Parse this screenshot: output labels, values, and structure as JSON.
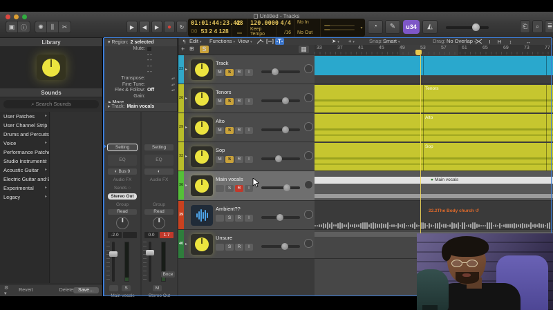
{
  "window": {
    "title": "Untitled - Tracks"
  },
  "lcd": {
    "smpte": "01:01:44:23.42",
    "position_ghost": "00",
    "position": "53 2 4 128",
    "midi_display": "48",
    "tempo": "120.0000",
    "tempo_mode": "Keep Tempo",
    "signature": "4/4",
    "division": "/16",
    "input": "No In",
    "output": "No Out"
  },
  "toolbar": {
    "badge": "u34"
  },
  "library": {
    "title": "Library",
    "sounds_title": "Sounds",
    "search_placeholder": "Search Sounds",
    "items": [
      "User Patches",
      "User Channel Strip S…",
      "Drums and Percussion",
      "Voice",
      "Performance Patches",
      "Studio Instruments",
      "Acoustic Guitar",
      "Electric Guitar and Ba…",
      "Experimental",
      "Legacy"
    ],
    "footer": {
      "revert": "Revert",
      "delete": "Delete",
      "save": "Save…"
    }
  },
  "inspector": {
    "region_label": "Region:",
    "region_value": "2 selected",
    "mute_label": "Mute:",
    "dash_rows": [
      "- -",
      "- -",
      "- -",
      "- -"
    ],
    "transpose_label": "Transpose:",
    "fine_tune_label": "Fine Tune:",
    "flex_label": "Flex & Follow:",
    "flex_value": "Off",
    "gain_label": "Gain:",
    "more_label": "More",
    "track_label": "Track:",
    "track_value": "Main vocals"
  },
  "channel_left": {
    "setting": "Setting",
    "eq": "EQ",
    "input": "Bus 9",
    "audio_fx": "Audio FX",
    "sends": "Sends",
    "output": "Stereo Out",
    "group": "Group",
    "automation": "Read",
    "value": "-2.0",
    "peak": "",
    "solo": "S",
    "name": "Main vocals"
  },
  "channel_right": {
    "setting": "Setting",
    "eq": "EQ",
    "audio_fx": "Audio FX",
    "group": "Group",
    "automation": "Read",
    "value": "0.0",
    "peak": "1.7",
    "bounce": "Bnce",
    "mute": "M",
    "name": "Stereo Out"
  },
  "tracks_toolbar": {
    "menus": {
      "edit": "Edit",
      "functions": "Functions",
      "view": "View"
    },
    "snap_label": "Snap:",
    "snap_value": "Smart",
    "drag_label": "Drag:",
    "drag_value": "No Overlap",
    "solo": "S",
    "add": "+"
  },
  "ruler": {
    "numbers": [
      "33",
      "37",
      "41",
      "45",
      "49",
      "53",
      "57",
      "61",
      "65",
      "69",
      "73",
      "77"
    ],
    "playhead_bar": "53"
  },
  "tracks": [
    {
      "num": "23",
      "name": "Track",
      "color": "#31a8c9",
      "m": "M",
      "s": "S",
      "r": "R",
      "i": "I",
      "s_on": true,
      "r_on": false,
      "selected": false,
      "disc": true,
      "num_light": false,
      "slider": 36,
      "icon": "knob"
    },
    {
      "num": "26",
      "name": "Tenors",
      "color": "#b9bd2a",
      "m": "M",
      "s": "S",
      "r": "R",
      "i": "I",
      "s_on": true,
      "r_on": false,
      "selected": false,
      "disc": true,
      "num_light": false,
      "slider": 62,
      "icon": "knob"
    },
    {
      "num": "29",
      "name": "Alto",
      "color": "#b9bd2a",
      "m": "M",
      "s": "S",
      "r": "R",
      "i": "I",
      "s_on": true,
      "r_on": false,
      "selected": false,
      "disc": true,
      "num_light": false,
      "slider": 62,
      "icon": "knob"
    },
    {
      "num": "32",
      "name": "Sop",
      "color": "#b9bd2a",
      "m": "M",
      "s": "S",
      "r": "R",
      "i": "I",
      "s_on": true,
      "r_on": false,
      "selected": false,
      "disc": true,
      "num_light": false,
      "slider": 45,
      "icon": "knob"
    },
    {
      "num": "36",
      "name": "Main vocals",
      "color": "#55bf38",
      "m": "",
      "s": "S",
      "r": "R",
      "i": "I",
      "s_on": false,
      "r_on": true,
      "selected": true,
      "disc": true,
      "num_light": false,
      "slider": 66,
      "icon": "knob"
    },
    {
      "num": "39",
      "name": "Ambient??",
      "color": "#c9411f",
      "m": "",
      "s": "S",
      "r": "R",
      "i": "I",
      "s_on": false,
      "r_on": false,
      "selected": false,
      "disc": false,
      "num_light": true,
      "slider": 48,
      "icon": "wave"
    },
    {
      "num": "40",
      "name": "Unsure",
      "color": "#2e7d3c",
      "m": "",
      "s": "S",
      "r": "R",
      "i": "I",
      "s_on": false,
      "r_on": false,
      "selected": false,
      "disc": true,
      "num_light": true,
      "slider": 60,
      "icon": "knob"
    }
  ],
  "lanes": {
    "tenors_label": "Tenors",
    "alto_label": "Alto",
    "sop_label": "Sop",
    "stack_label": "Main vocals",
    "audio_label": "22.2The Body church"
  }
}
